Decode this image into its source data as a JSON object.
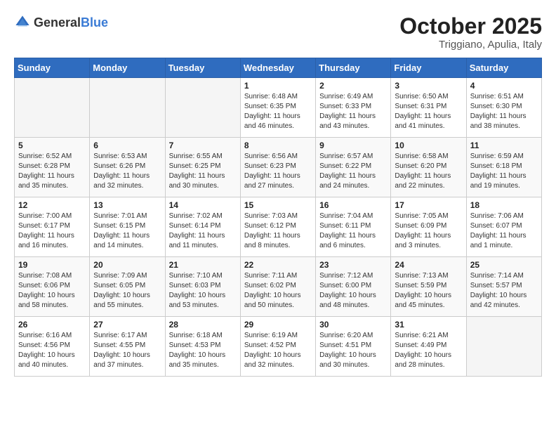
{
  "header": {
    "logo": {
      "general": "General",
      "blue": "Blue"
    },
    "month": "October 2025",
    "location": "Triggiano, Apulia, Italy"
  },
  "weekdays": [
    "Sunday",
    "Monday",
    "Tuesday",
    "Wednesday",
    "Thursday",
    "Friday",
    "Saturday"
  ],
  "weeks": [
    [
      {
        "day": "",
        "sunrise": "",
        "sunset": "",
        "daylight": ""
      },
      {
        "day": "",
        "sunrise": "",
        "sunset": "",
        "daylight": ""
      },
      {
        "day": "",
        "sunrise": "",
        "sunset": "",
        "daylight": ""
      },
      {
        "day": "1",
        "sunrise": "Sunrise: 6:48 AM",
        "sunset": "Sunset: 6:35 PM",
        "daylight": "Daylight: 11 hours and 46 minutes."
      },
      {
        "day": "2",
        "sunrise": "Sunrise: 6:49 AM",
        "sunset": "Sunset: 6:33 PM",
        "daylight": "Daylight: 11 hours and 43 minutes."
      },
      {
        "day": "3",
        "sunrise": "Sunrise: 6:50 AM",
        "sunset": "Sunset: 6:31 PM",
        "daylight": "Daylight: 11 hours and 41 minutes."
      },
      {
        "day": "4",
        "sunrise": "Sunrise: 6:51 AM",
        "sunset": "Sunset: 6:30 PM",
        "daylight": "Daylight: 11 hours and 38 minutes."
      }
    ],
    [
      {
        "day": "5",
        "sunrise": "Sunrise: 6:52 AM",
        "sunset": "Sunset: 6:28 PM",
        "daylight": "Daylight: 11 hours and 35 minutes."
      },
      {
        "day": "6",
        "sunrise": "Sunrise: 6:53 AM",
        "sunset": "Sunset: 6:26 PM",
        "daylight": "Daylight: 11 hours and 32 minutes."
      },
      {
        "day": "7",
        "sunrise": "Sunrise: 6:55 AM",
        "sunset": "Sunset: 6:25 PM",
        "daylight": "Daylight: 11 hours and 30 minutes."
      },
      {
        "day": "8",
        "sunrise": "Sunrise: 6:56 AM",
        "sunset": "Sunset: 6:23 PM",
        "daylight": "Daylight: 11 hours and 27 minutes."
      },
      {
        "day": "9",
        "sunrise": "Sunrise: 6:57 AM",
        "sunset": "Sunset: 6:22 PM",
        "daylight": "Daylight: 11 hours and 24 minutes."
      },
      {
        "day": "10",
        "sunrise": "Sunrise: 6:58 AM",
        "sunset": "Sunset: 6:20 PM",
        "daylight": "Daylight: 11 hours and 22 minutes."
      },
      {
        "day": "11",
        "sunrise": "Sunrise: 6:59 AM",
        "sunset": "Sunset: 6:18 PM",
        "daylight": "Daylight: 11 hours and 19 minutes."
      }
    ],
    [
      {
        "day": "12",
        "sunrise": "Sunrise: 7:00 AM",
        "sunset": "Sunset: 6:17 PM",
        "daylight": "Daylight: 11 hours and 16 minutes."
      },
      {
        "day": "13",
        "sunrise": "Sunrise: 7:01 AM",
        "sunset": "Sunset: 6:15 PM",
        "daylight": "Daylight: 11 hours and 14 minutes."
      },
      {
        "day": "14",
        "sunrise": "Sunrise: 7:02 AM",
        "sunset": "Sunset: 6:14 PM",
        "daylight": "Daylight: 11 hours and 11 minutes."
      },
      {
        "day": "15",
        "sunrise": "Sunrise: 7:03 AM",
        "sunset": "Sunset: 6:12 PM",
        "daylight": "Daylight: 11 hours and 8 minutes."
      },
      {
        "day": "16",
        "sunrise": "Sunrise: 7:04 AM",
        "sunset": "Sunset: 6:11 PM",
        "daylight": "Daylight: 11 hours and 6 minutes."
      },
      {
        "day": "17",
        "sunrise": "Sunrise: 7:05 AM",
        "sunset": "Sunset: 6:09 PM",
        "daylight": "Daylight: 11 hours and 3 minutes."
      },
      {
        "day": "18",
        "sunrise": "Sunrise: 7:06 AM",
        "sunset": "Sunset: 6:07 PM",
        "daylight": "Daylight: 11 hours and 1 minute."
      }
    ],
    [
      {
        "day": "19",
        "sunrise": "Sunrise: 7:08 AM",
        "sunset": "Sunset: 6:06 PM",
        "daylight": "Daylight: 10 hours and 58 minutes."
      },
      {
        "day": "20",
        "sunrise": "Sunrise: 7:09 AM",
        "sunset": "Sunset: 6:05 PM",
        "daylight": "Daylight: 10 hours and 55 minutes."
      },
      {
        "day": "21",
        "sunrise": "Sunrise: 7:10 AM",
        "sunset": "Sunset: 6:03 PM",
        "daylight": "Daylight: 10 hours and 53 minutes."
      },
      {
        "day": "22",
        "sunrise": "Sunrise: 7:11 AM",
        "sunset": "Sunset: 6:02 PM",
        "daylight": "Daylight: 10 hours and 50 minutes."
      },
      {
        "day": "23",
        "sunrise": "Sunrise: 7:12 AM",
        "sunset": "Sunset: 6:00 PM",
        "daylight": "Daylight: 10 hours and 48 minutes."
      },
      {
        "day": "24",
        "sunrise": "Sunrise: 7:13 AM",
        "sunset": "Sunset: 5:59 PM",
        "daylight": "Daylight: 10 hours and 45 minutes."
      },
      {
        "day": "25",
        "sunrise": "Sunrise: 7:14 AM",
        "sunset": "Sunset: 5:57 PM",
        "daylight": "Daylight: 10 hours and 42 minutes."
      }
    ],
    [
      {
        "day": "26",
        "sunrise": "Sunrise: 6:16 AM",
        "sunset": "Sunset: 4:56 PM",
        "daylight": "Daylight: 10 hours and 40 minutes."
      },
      {
        "day": "27",
        "sunrise": "Sunrise: 6:17 AM",
        "sunset": "Sunset: 4:55 PM",
        "daylight": "Daylight: 10 hours and 37 minutes."
      },
      {
        "day": "28",
        "sunrise": "Sunrise: 6:18 AM",
        "sunset": "Sunset: 4:53 PM",
        "daylight": "Daylight: 10 hours and 35 minutes."
      },
      {
        "day": "29",
        "sunrise": "Sunrise: 6:19 AM",
        "sunset": "Sunset: 4:52 PM",
        "daylight": "Daylight: 10 hours and 32 minutes."
      },
      {
        "day": "30",
        "sunrise": "Sunrise: 6:20 AM",
        "sunset": "Sunset: 4:51 PM",
        "daylight": "Daylight: 10 hours and 30 minutes."
      },
      {
        "day": "31",
        "sunrise": "Sunrise: 6:21 AM",
        "sunset": "Sunset: 4:49 PM",
        "daylight": "Daylight: 10 hours and 28 minutes."
      },
      {
        "day": "",
        "sunrise": "",
        "sunset": "",
        "daylight": ""
      }
    ]
  ]
}
